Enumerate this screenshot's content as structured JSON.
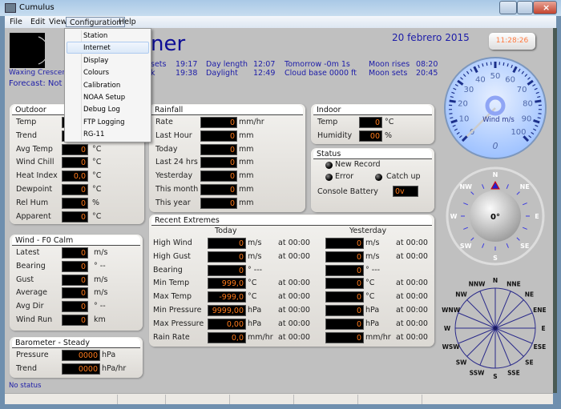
{
  "window": {
    "title": "Cumulus"
  },
  "menu": [
    "File",
    "Edit",
    "View",
    "Configuration",
    "Help"
  ],
  "configuration_menu": [
    "Station",
    "Internet",
    "Display",
    "Colours",
    "Calibration",
    "NOAA Setup",
    "Debug Log",
    "FTP Logging",
    "RG-11"
  ],
  "header": {
    "title_partial": "ner",
    "date": "20 febrero 2015",
    "clock": "11:28:26",
    "moon_phase": "Waxing Crescent",
    "forecast": "Forecast: Not",
    "row1": [
      "sets",
      "19:17",
      "Day length",
      "12:07",
      "Tomorrow -0m 1s",
      "Moon rises",
      "08:20"
    ],
    "row2": [
      "k",
      "19:38",
      "Daylight",
      "12:49",
      "Cloud base 0000 ft",
      "Moon sets",
      "20:45"
    ]
  },
  "outdoor": {
    "title": "Outdoor",
    "rows": [
      {
        "label": "Temp",
        "value": "",
        "unit": ""
      },
      {
        "label": "Trend",
        "value": "",
        "unit": ""
      },
      {
        "label": "Avg Temp",
        "value": "0",
        "unit": "°C"
      },
      {
        "label": "Wind Chill",
        "value": "0",
        "unit": "°C"
      },
      {
        "label": "Heat Index",
        "value": "0,0",
        "unit": "°C"
      },
      {
        "label": "Dewpoint",
        "value": "0",
        "unit": "°C"
      },
      {
        "label": "Rel Hum",
        "value": "0",
        "unit": "%"
      },
      {
        "label": "Apparent",
        "value": "0",
        "unit": "°C"
      }
    ]
  },
  "wind": {
    "title": "Wind - F0 Calm",
    "rows": [
      {
        "label": "Latest",
        "value": "0",
        "unit": "m/s"
      },
      {
        "label": "Bearing",
        "value": "0",
        "unit": "° --"
      },
      {
        "label": "Gust",
        "value": "0",
        "unit": "m/s"
      },
      {
        "label": "Average",
        "value": "0",
        "unit": "m/s"
      },
      {
        "label": "Avg Dir",
        "value": "0",
        "unit": "° --"
      },
      {
        "label": "Wind Run",
        "value": "0",
        "unit": "km"
      }
    ]
  },
  "barometer": {
    "title": "Barometer - Steady",
    "rows": [
      {
        "label": "Pressure",
        "value": "0000",
        "unit": "hPa"
      },
      {
        "label": "Trend",
        "value": "0000",
        "unit": "hPa/hr"
      }
    ]
  },
  "rainfall": {
    "title": "Rainfall",
    "rows": [
      {
        "label": "Rate",
        "value": "0",
        "unit": "mm/hr"
      },
      {
        "label": "Last Hour",
        "value": "0",
        "unit": "mm"
      },
      {
        "label": "Today",
        "value": "0",
        "unit": "mm"
      },
      {
        "label": "Last 24 hrs",
        "value": "0",
        "unit": "mm"
      },
      {
        "label": "Yesterday",
        "value": "0",
        "unit": "mm"
      },
      {
        "label": "This month",
        "value": "0",
        "unit": "mm"
      },
      {
        "label": "This year",
        "value": "0",
        "unit": "mm"
      }
    ]
  },
  "indoor": {
    "title": "Indoor",
    "rows": [
      {
        "label": "Temp",
        "value": "0",
        "unit": "°C"
      },
      {
        "label": "Humidity",
        "value": "00",
        "unit": "%"
      }
    ]
  },
  "status": {
    "title": "Status",
    "new_record": "New Record",
    "error": "Error",
    "catch_up": "Catch up",
    "battery_label": "Console Battery",
    "battery_value": "0v"
  },
  "extremes": {
    "title": "Recent Extremes",
    "today": "Today",
    "yesterday": "Yesterday",
    "rows": [
      {
        "label": "High Wind",
        "t": "0",
        "tu": "m/s",
        "ta": "at 00:00",
        "y": "0",
        "yu": "m/s",
        "ya": "at 00:00"
      },
      {
        "label": "High Gust",
        "t": "0",
        "tu": "m/s",
        "ta": "at 00:00",
        "y": "0",
        "yu": "m/s",
        "ya": "at 00:00"
      },
      {
        "label": "Bearing",
        "t": "0",
        "tu": "°  ---",
        "ta": "",
        "y": "0",
        "yu": "°  ---",
        "ya": ""
      },
      {
        "label": "Min Temp",
        "t": "999,0",
        "tu": "°C",
        "ta": "at 00:00",
        "y": "0",
        "yu": "°C",
        "ya": "at 00:00"
      },
      {
        "label": "Max Temp",
        "t": "-999,0",
        "tu": "°C",
        "ta": "at 00:00",
        "y": "0",
        "yu": "°C",
        "ya": "at 00:00"
      },
      {
        "label": "Min Pressure",
        "t": "9999,00",
        "tu": "hPa",
        "ta": "at 00:00",
        "y": "0",
        "yu": "hPa",
        "ya": "at 00:00"
      },
      {
        "label": "Max Pressure",
        "t": "0,00",
        "tu": "hPa",
        "ta": "at 00:00",
        "y": "0",
        "yu": "hPa",
        "ya": "at 00:00"
      },
      {
        "label": "Rain Rate",
        "t": "0,0",
        "tu": "mm/hr",
        "ta": "at 00:00",
        "y": "0",
        "yu": "mm/hr",
        "ya": "at 00:00"
      }
    ]
  },
  "wind_gauge": {
    "label": "Wind m/s",
    "value": "0",
    "ticks": [
      "0",
      "10",
      "20",
      "30",
      "40",
      "50",
      "60",
      "70",
      "80",
      "90",
      "100"
    ]
  },
  "compass": {
    "value": "0°",
    "labels": [
      "N",
      "NE",
      "E",
      "SE",
      "S",
      "SW",
      "W",
      "NW"
    ]
  },
  "wind_rose": {
    "labels": [
      "N",
      "NNE",
      "NE",
      "ENE",
      "E",
      "ESE",
      "SE",
      "SSE",
      "S",
      "SSW",
      "SW",
      "WSW",
      "W",
      "WNW",
      "NW",
      "NNW"
    ]
  },
  "status_text": "No status",
  "colors": {
    "background": "#c0c0c0",
    "value_text": "#ff7a1a",
    "info_text": "#1c1ca8"
  }
}
